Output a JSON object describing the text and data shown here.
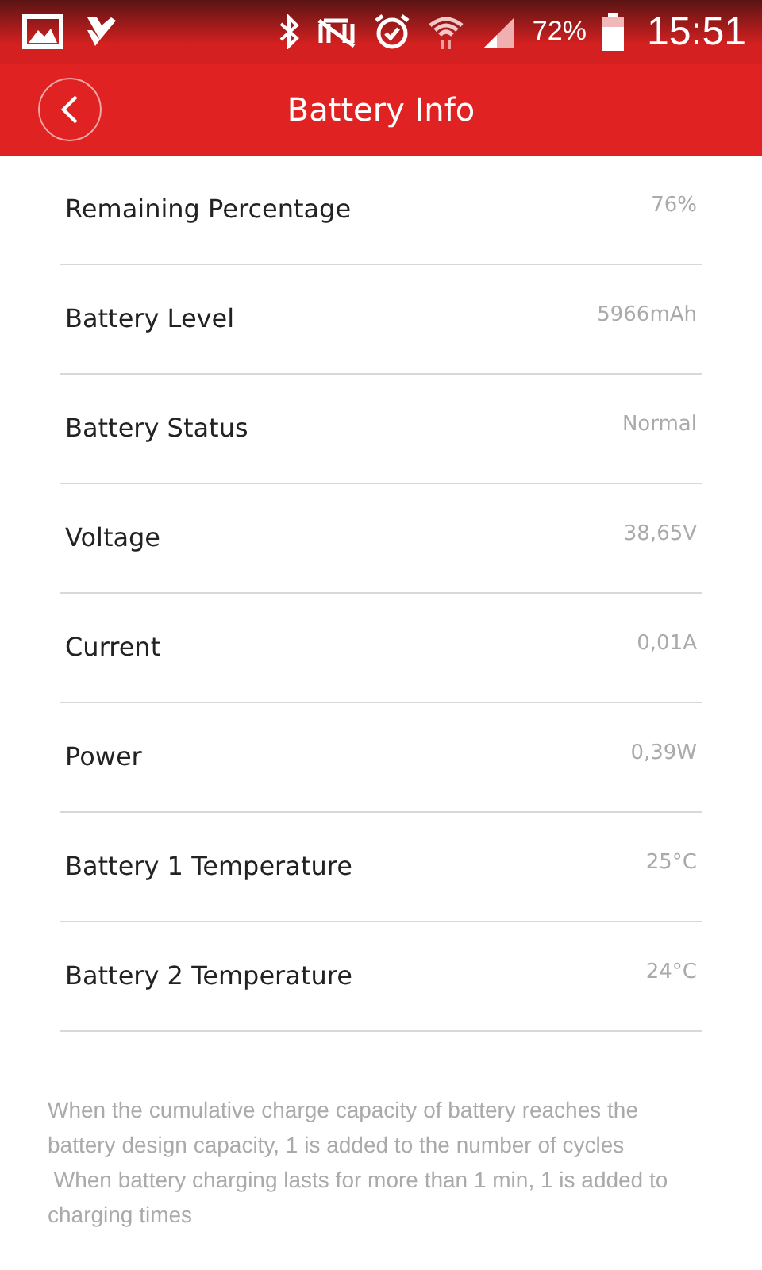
{
  "status_bar": {
    "battery_percent": "72%",
    "time": "15:51"
  },
  "header": {
    "title": "Battery Info"
  },
  "rows": [
    {
      "label": "Remaining Percentage",
      "value": "76%"
    },
    {
      "label": "Battery Level",
      "value": "5966mAh"
    },
    {
      "label": "Battery Status",
      "value": "Normal"
    },
    {
      "label": "Voltage",
      "value": "38,65V"
    },
    {
      "label": "Current",
      "value": "0,01A"
    },
    {
      "label": "Power",
      "value": "0,39W"
    },
    {
      "label": "Battery 1 Temperature",
      "value": "25°C"
    },
    {
      "label": "Battery 2 Temperature",
      "value": "24°C"
    }
  ],
  "footnotes": [
    "When the cumulative charge capacity of battery reaches the battery design capacity, 1 is added to the number of cycles",
    " When battery charging lasts for more than 1 min, 1 is added to charging times"
  ]
}
